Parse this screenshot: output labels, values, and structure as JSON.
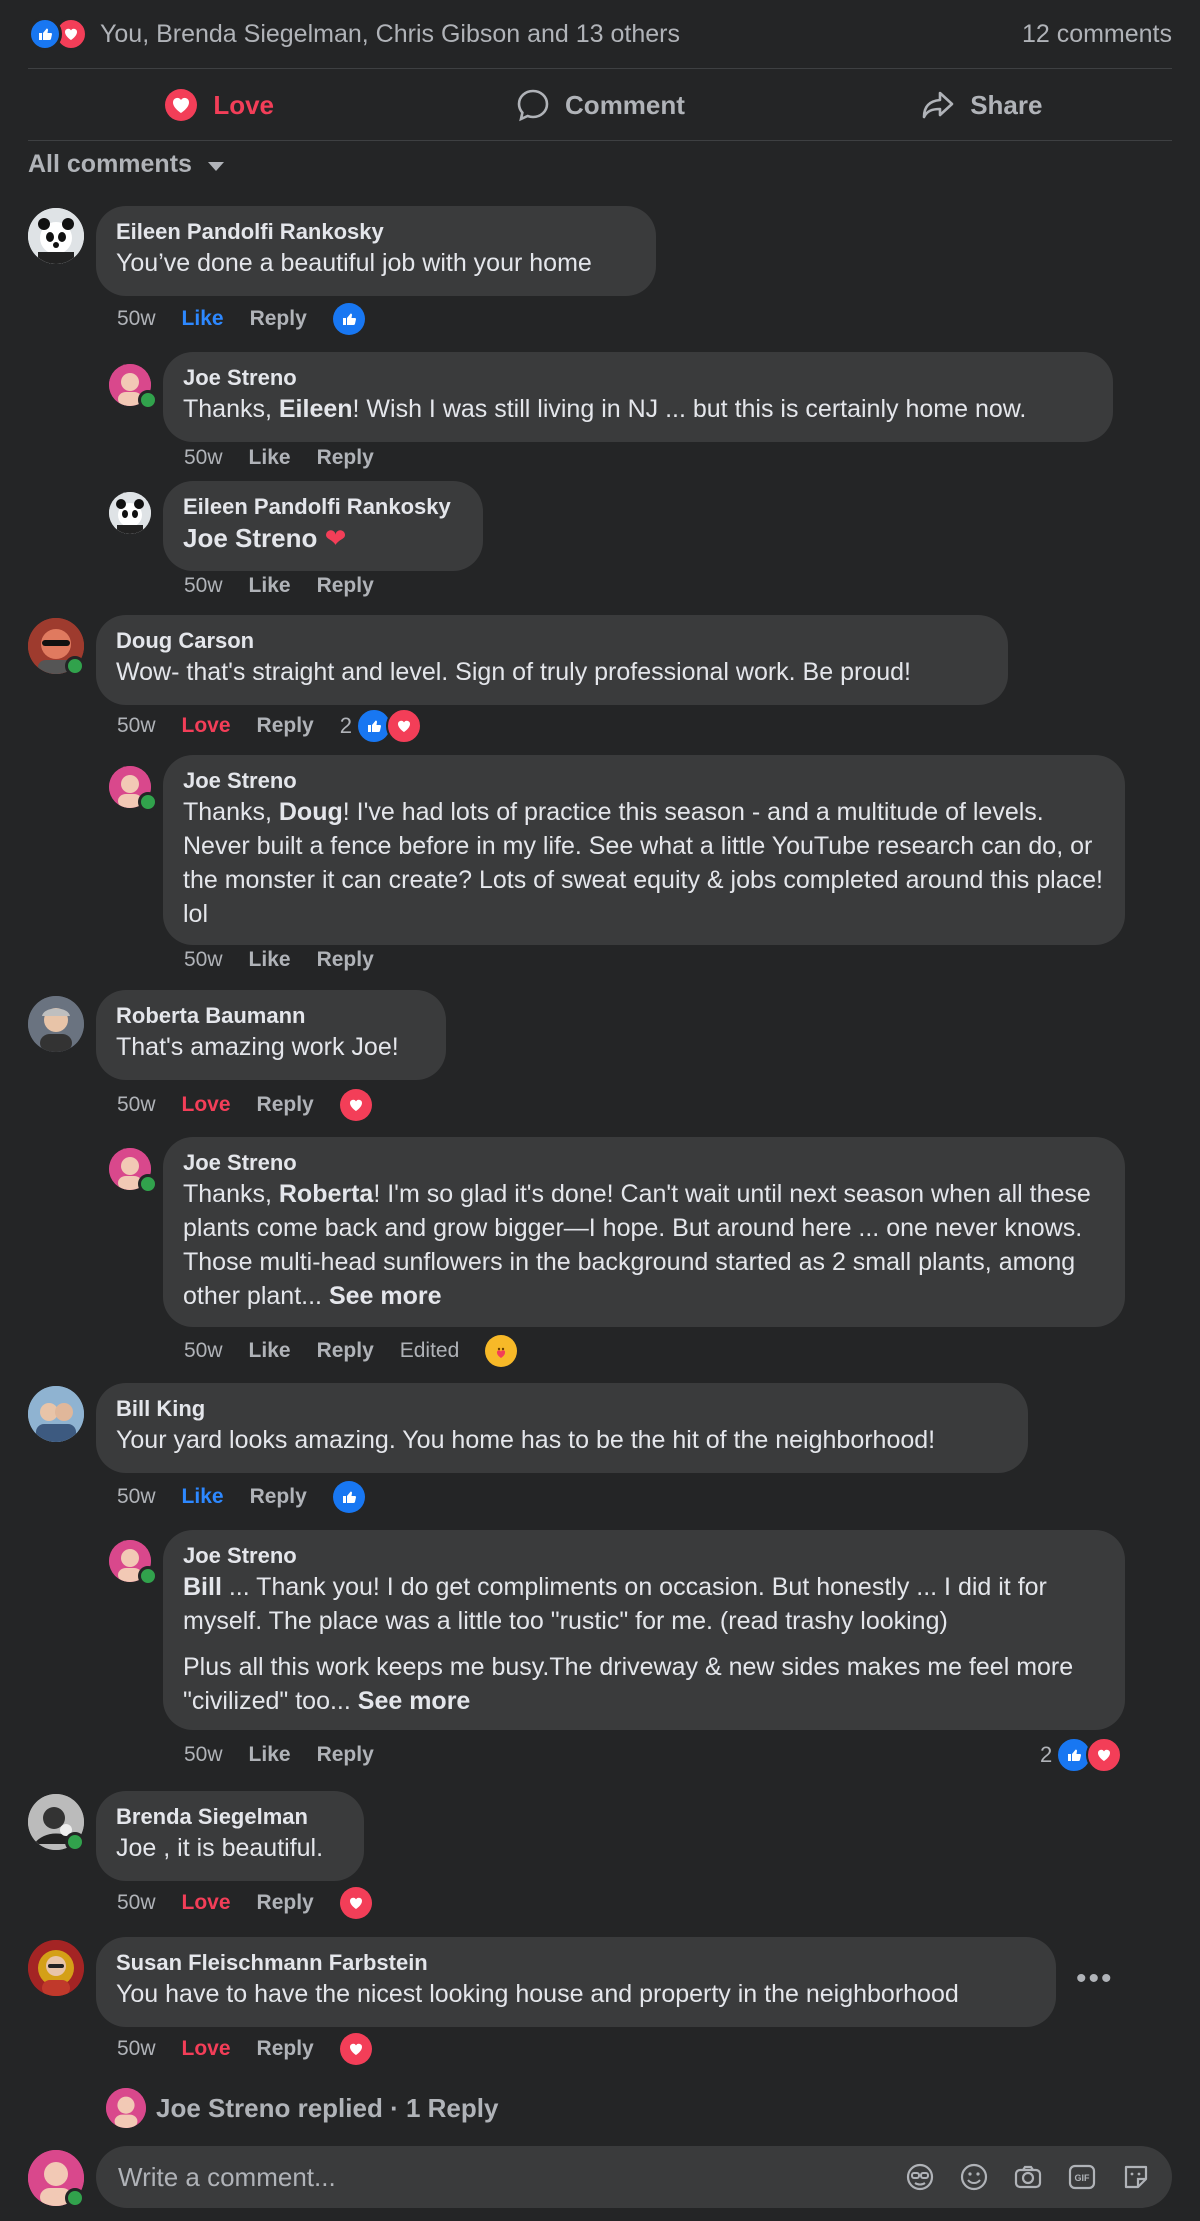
{
  "summary": {
    "text": "You, Brenda Siegelman, Chris Gibson and 13 others",
    "comments": "12 comments"
  },
  "actions": {
    "love": "Love",
    "comment": "Comment",
    "share": "Share"
  },
  "filter": {
    "label": "All comments"
  },
  "comments": [
    {
      "name": "Eileen Pandolfi Rankosky",
      "text": "You’ve done a beautiful job with your home",
      "time": "50w",
      "react": "Like",
      "reply": "Reply"
    },
    {
      "name": "Joe Streno",
      "pre": "Thanks, ",
      "bold": "Eileen",
      "text": "! Wish I was still living in NJ ... but this is certainly home now.",
      "time": "50w",
      "like": "Like",
      "reply": "Reply"
    },
    {
      "name": "Eileen Pandolfi Rankosky",
      "text": "Joe Streno",
      "time": "50w",
      "like": "Like",
      "reply": "Reply"
    },
    {
      "name": "Doug Carson",
      "text": "Wow- that's straight and level. Sign of truly professional work. Be proud!",
      "time": "50w",
      "react": "Love",
      "reply": "Reply",
      "count": "2"
    },
    {
      "name": "Joe Streno",
      "pre": "Thanks, ",
      "bold": "Doug",
      "text": "! I've had lots of practice this season - and a multitude of levels. Never built a fence before in my life. See what a little YouTube research can do, or the monster it can create? Lots of sweat equity & jobs completed around this place! lol",
      "time": "50w",
      "like": "Like",
      "reply": "Reply"
    },
    {
      "name": "Roberta Baumann",
      "text": "That's amazing work Joe!",
      "time": "50w",
      "react": "Love",
      "reply": "Reply"
    },
    {
      "name": "Joe Streno",
      "pre": "Thanks, ",
      "bold": "Roberta",
      "text": "! I'm so glad it's done! Can't wait until next season when all these plants come back and grow bigger—I hope. But around here ... one never knows. Those multi-head sunflowers in the background started as 2 small plants, among other plant... ",
      "see_more": "See more",
      "time": "50w",
      "like": "Like",
      "reply": "Reply",
      "edited": "Edited"
    },
    {
      "name": "Bill King",
      "text": "Your yard looks amazing. You home has to be the hit of the neighborhood!",
      "time": "50w",
      "react": "Like",
      "reply": "Reply"
    },
    {
      "name": "Joe Streno",
      "bold": "Bill",
      "text": " ... Thank you! I do get compliments on occasion. But honestly ... I did it for myself. The place was a little too \"rustic\" for me. (read trashy looking)",
      "text2": "Plus all this work keeps me busy.The driveway & new sides makes me feel more \"civilized\" too... ",
      "see_more": "See more",
      "time": "50w",
      "like": "Like",
      "reply": "Reply",
      "count": "2"
    },
    {
      "name": "Brenda Siegelman",
      "text": "Joe , it is beautiful.",
      "time": "50w",
      "react": "Love",
      "reply": "Reply"
    },
    {
      "name": "Susan Fleischmann Farbstein",
      "text": "You have to have the nicest looking house and property in the neighborhood",
      "time": "50w",
      "react": "Love",
      "reply": "Reply"
    }
  ],
  "replied": {
    "text": "Joe Streno replied · 1 Reply"
  },
  "composer": {
    "placeholder": "Write a comment..."
  }
}
